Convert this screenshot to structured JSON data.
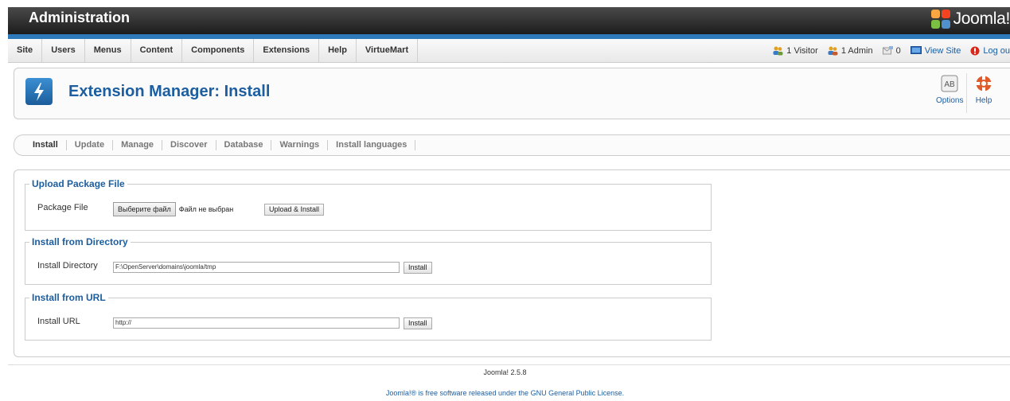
{
  "header": {
    "title": "Administration",
    "logo_text": "Joomla!"
  },
  "menu": {
    "items": [
      "Site",
      "Users",
      "Menus",
      "Content",
      "Components",
      "Extensions",
      "Help",
      "VirtueMart"
    ]
  },
  "status": {
    "visitors": "1 Visitor",
    "admins": "1 Admin",
    "messages": "0",
    "view_site": "View Site",
    "logout": "Log ou"
  },
  "page": {
    "title": "Extension Manager: Install"
  },
  "toolbar": {
    "options_label": "Options",
    "help_label": "Help",
    "options_icon_text": "AB"
  },
  "subnav": {
    "items": [
      "Install",
      "Update",
      "Manage",
      "Discover",
      "Database",
      "Warnings",
      "Install languages"
    ],
    "active": "Install"
  },
  "upload": {
    "legend": "Upload Package File",
    "label": "Package File",
    "choose_file": "Выберите файл",
    "no_file": "Файл не выбран",
    "button": "Upload & Install"
  },
  "directory": {
    "legend": "Install from Directory",
    "label": "Install Directory",
    "value": "F:\\OpenServer\\domains\\joomla/tmp",
    "button": "Install"
  },
  "url": {
    "legend": "Install from URL",
    "label": "Install URL",
    "value": "http://",
    "button": "Install"
  },
  "footer": {
    "version": "Joomla! 2.5.8",
    "license_prefix": "Joomla!® is free software released under the ",
    "license_link": "GNU General Public License",
    "license_suffix": "."
  },
  "colors": {
    "accent": "#1c5ea0",
    "header_bg": "#2a2a2a",
    "blue_bar": "#2e79b9"
  }
}
